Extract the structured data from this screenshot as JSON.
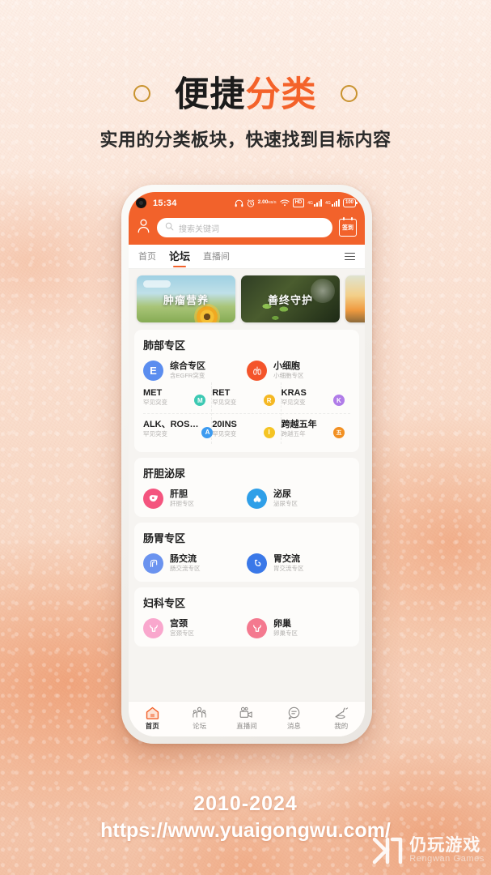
{
  "headline": {
    "part1": "便捷",
    "part2": "分类",
    "subtitle": "实用的分类板块，快速找到目标内容"
  },
  "phone": {
    "statusbar": {
      "time": "15:34",
      "netspeed_value": "2.00",
      "netspeed_unit": "KB/S",
      "hd_label": "HD",
      "battery": "100",
      "signal_label_1": "4G",
      "signal_label_2": "4G",
      "icons": [
        "headphone-icon",
        "alarm-icon",
        "netspeed-icon",
        "wifi-icon",
        "hd-icon",
        "signal-icon",
        "signal-icon",
        "battery-icon"
      ]
    },
    "header": {
      "profile_icon": "person-icon",
      "search_placeholder": "搜索关键词",
      "search_value": "",
      "signin_label": "签到",
      "accent_color": "#f2622b"
    },
    "tabs": [
      {
        "label": "首页",
        "active": false
      },
      {
        "label": "论坛",
        "active": true
      },
      {
        "label": "直播间",
        "active": false
      }
    ],
    "menu_icon": "hamburger-icon",
    "banners": [
      {
        "title": "肿瘤营养"
      },
      {
        "title": "善终守护"
      },
      {
        "title": ""
      }
    ],
    "sections": [
      {
        "title": "肺部专区",
        "items": [
          {
            "title": "综合专区",
            "sub": "含EGFR突变",
            "badge": "E",
            "color": "#5b8def",
            "icon": "e-letter-icon"
          },
          {
            "title": "小细胞",
            "sub": "小细胞专区",
            "badge": "",
            "color": "#f4542a",
            "icon": "lung-icon"
          }
        ],
        "gene_rows": [
          [
            {
              "title": "MET",
              "sub": "罕见突变",
              "badge": "M",
              "color": "#3dc9b3"
            },
            {
              "title": "RET",
              "sub": "罕见突变",
              "badge": "R",
              "color": "#f5b823"
            },
            {
              "title": "KRAS",
              "sub": "罕见突变",
              "badge": "K",
              "color": "#b07ce8"
            }
          ],
          [
            {
              "title": "ALK、ROS…",
              "sub": "罕见突变",
              "badge": "A",
              "color": "#3d9bf0"
            },
            {
              "title": "20INS",
              "sub": "罕见突变",
              "badge": "I",
              "color": "#f5c423"
            },
            {
              "title": "跨越五年",
              "sub": "跨越五年",
              "badge": "五",
              "color": "#f29022"
            }
          ]
        ]
      },
      {
        "title": "肝胆泌尿",
        "items": [
          {
            "title": "肝胆",
            "sub": "肝胆专区",
            "badge": "",
            "color": "#f4547e",
            "icon": "liver-icon"
          },
          {
            "title": "泌尿",
            "sub": "泌尿专区",
            "badge": "",
            "color": "#2f9fe8",
            "icon": "kidney-icon"
          }
        ],
        "gene_rows": []
      },
      {
        "title": "肠胃专区",
        "items": [
          {
            "title": "肠交流",
            "sub": "肠交流专区",
            "badge": "",
            "color": "#6b93ef",
            "icon": "intestine-icon"
          },
          {
            "title": "胃交流",
            "sub": "胃交流专区",
            "badge": "",
            "color": "#3a78e8",
            "icon": "stomach-icon"
          }
        ],
        "gene_rows": []
      },
      {
        "title": "妇科专区",
        "items": [
          {
            "title": "宫颈",
            "sub": "宫颈专区",
            "badge": "",
            "color": "#f9a7cd",
            "icon": "uterus-icon"
          },
          {
            "title": "卵巢",
            "sub": "卵巢专区",
            "badge": "",
            "color": "#f4798f",
            "icon": "ovary-icon"
          }
        ],
        "gene_rows": []
      }
    ],
    "bottomnav": [
      {
        "label": "首页",
        "icon": "home-icon",
        "active": true
      },
      {
        "label": "论坛",
        "icon": "forum-icon",
        "active": false
      },
      {
        "label": "直播间",
        "icon": "video-camera-icon",
        "active": false
      },
      {
        "label": "消息",
        "icon": "message-icon",
        "active": false
      },
      {
        "label": "我的",
        "icon": "profile-icon",
        "active": false
      }
    ]
  },
  "footer": {
    "years": "2010-2024",
    "url": "https://www.yuaigongwu.com/"
  },
  "watermark": {
    "cn": "仍玩游戏",
    "en": "Rengwan Games"
  }
}
